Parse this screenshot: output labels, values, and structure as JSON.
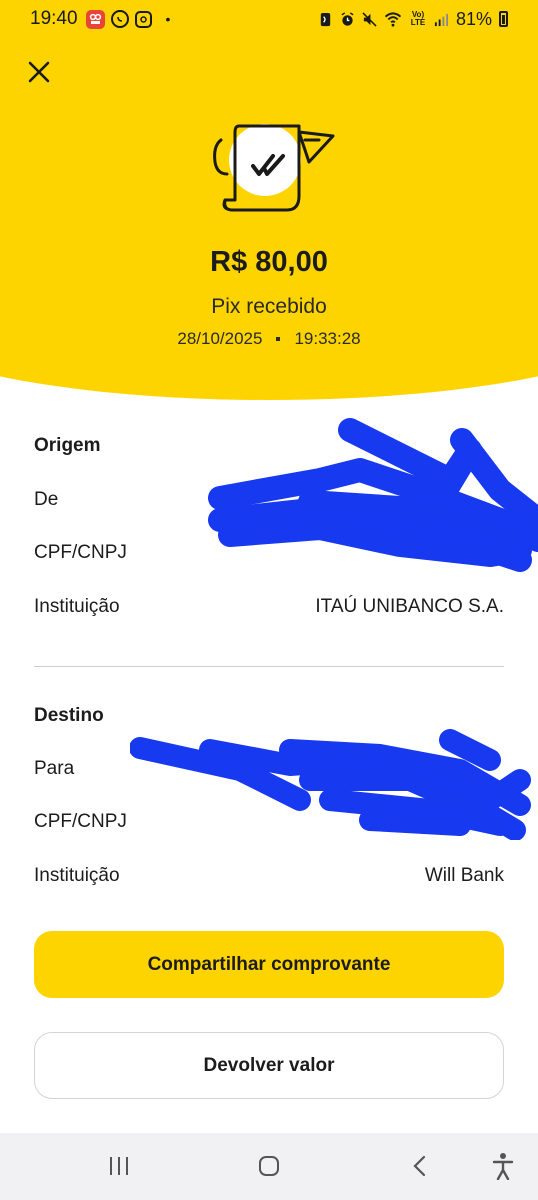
{
  "status_bar": {
    "time": "19:40",
    "notification_dot": "•",
    "battery_percent": "81%",
    "volte_label": "Vo) LTE"
  },
  "header": {
    "close_icon": "close-icon",
    "illustration_icon": "receipt-check-icon",
    "amount": "R$ 80,00",
    "status": "Pix recebido",
    "date": "28/10/2025",
    "time": "19:33:28"
  },
  "origin": {
    "title": "Origem",
    "rows": [
      {
        "label": "De",
        "value": ""
      },
      {
        "label": "CPF/CNPJ",
        "value": ""
      },
      {
        "label": "Instituição",
        "value": "ITAÚ UNIBANCO S.A."
      }
    ]
  },
  "destination": {
    "title": "Destino",
    "rows": [
      {
        "label": "Para",
        "value": ""
      },
      {
        "label": "CPF/CNPJ",
        "value": ""
      },
      {
        "label": "Instituição",
        "value": "Will Bank"
      }
    ]
  },
  "actions": {
    "share_label": "Compartilhar comprovante",
    "return_label": "Devolver valor"
  },
  "nav": {
    "recents_icon": "recents-icon",
    "home_icon": "home-icon",
    "back_icon": "back-icon",
    "accessibility_icon": "accessibility-icon"
  },
  "colors": {
    "brand_yellow": "#FDD400",
    "redaction_blue": "#1739F0"
  }
}
